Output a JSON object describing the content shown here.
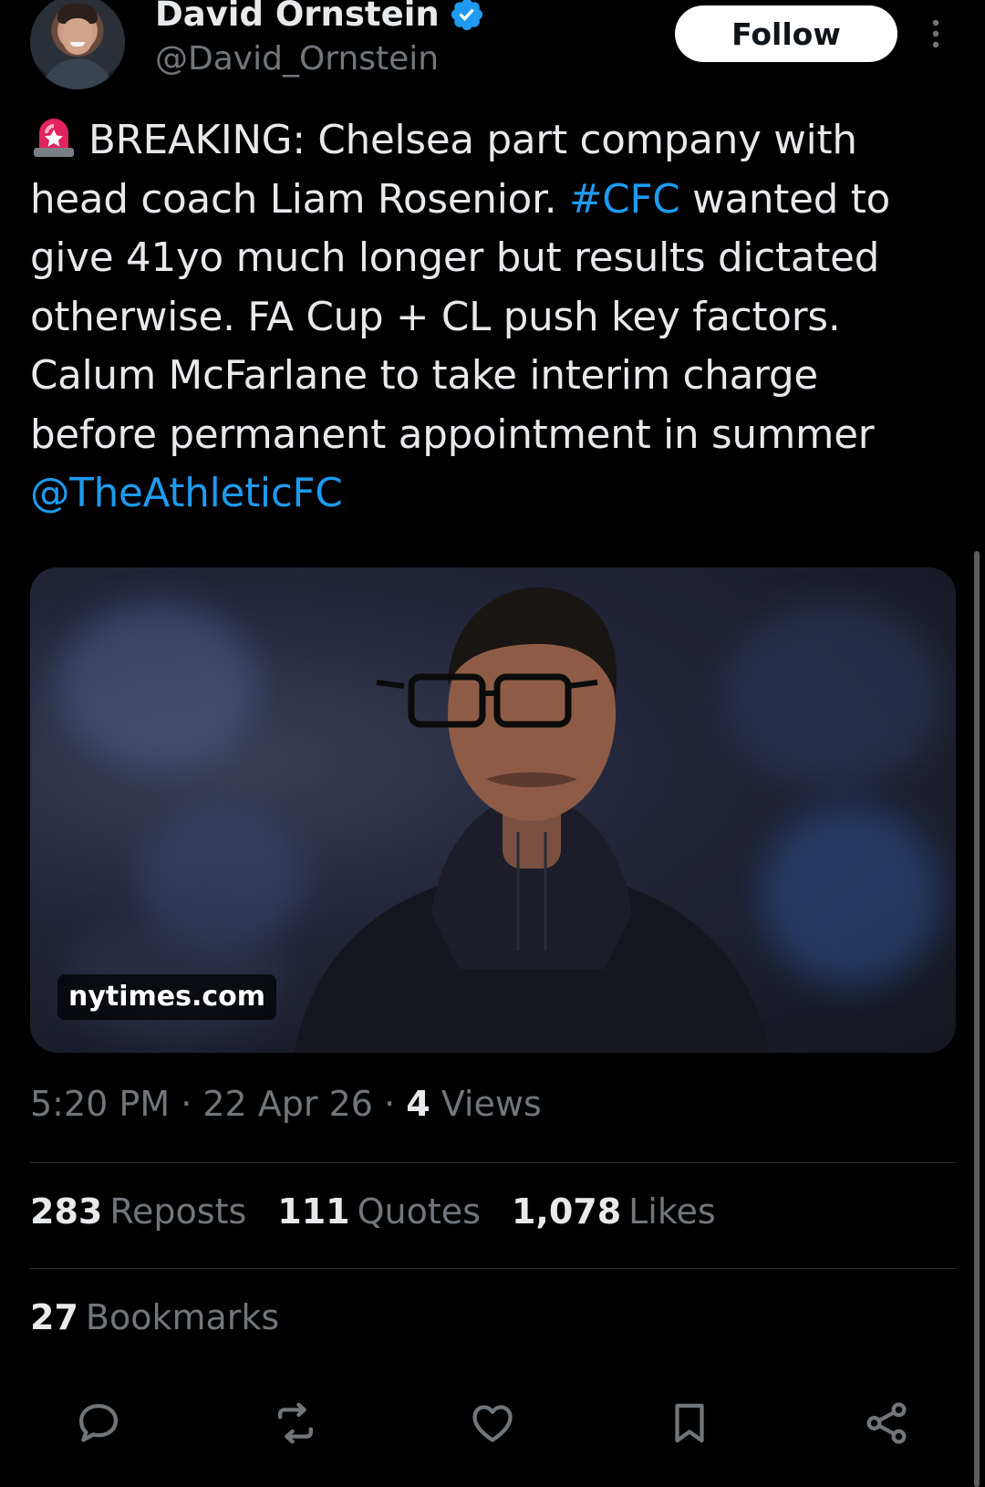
{
  "author": {
    "display_name": "David Ornstein",
    "handle": "@David_Ornstein",
    "verified": true
  },
  "follow_label": "Follow",
  "tweet": {
    "lines": [
      {
        "parts": [
          {
            "text": "BREAKING: Chelsea part company with",
            "link": false
          }
        ],
        "siren": true
      },
      {
        "parts": [
          {
            "text": "head coach Liam Rosenior. ",
            "link": false
          },
          {
            "text": "#CFC",
            "link": true
          },
          {
            "text": " wanted to",
            "link": false
          }
        ]
      },
      {
        "parts": [
          {
            "text": "give 41yo much longer but results dictated",
            "link": false
          }
        ]
      },
      {
        "parts": [
          {
            "text": "otherwise. FA Cup + CL push key factors.",
            "link": false
          }
        ]
      },
      {
        "parts": [
          {
            "text": "Calum McFarlane to take interim charge",
            "link": false
          }
        ]
      },
      {
        "parts": [
          {
            "text": "before permanent appointment in summer",
            "link": false
          }
        ]
      },
      {
        "parts": [
          {
            "text": "@TheAthleticFC",
            "link": true
          }
        ]
      }
    ]
  },
  "card": {
    "domain": "nytimes.com"
  },
  "meta": {
    "time": "5:20 PM",
    "sep1": " · ",
    "date": "22 Apr 26",
    "sep2": " · ",
    "views_count": "4",
    "views_label": " Views"
  },
  "stats": {
    "reposts_count": "283",
    "reposts_label": "Reposts",
    "quotes_count": "111",
    "quotes_label": "Quotes",
    "likes_count": "1,078",
    "likes_label": "Likes",
    "bookmarks_count": "27",
    "bookmarks_label": "Bookmarks"
  },
  "icons": {
    "reply": "reply-icon",
    "repost": "repost-icon",
    "like": "heart-icon",
    "bookmark": "bookmark-icon",
    "share": "share-icon"
  },
  "colors": {
    "background": "#000000",
    "text": "#e7e9ea",
    "secondary": "#71767b",
    "link": "#1d9bf0",
    "verified": "#1d9bf0",
    "siren": "#e0245e"
  }
}
